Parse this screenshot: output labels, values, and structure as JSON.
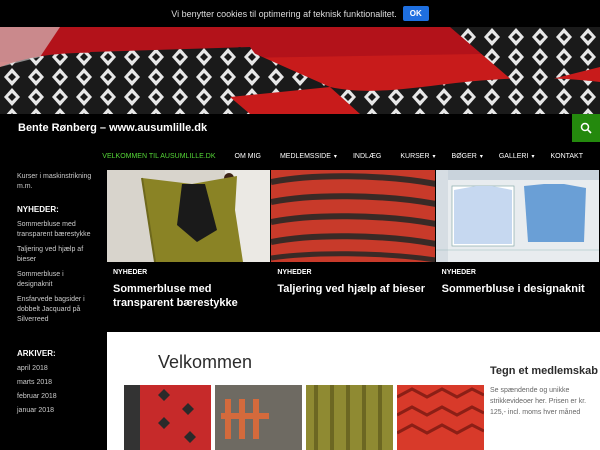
{
  "cookie": {
    "text": "Vi benytter cookies til optimering af teknisk funktionalitet.",
    "ok": "OK"
  },
  "site": {
    "title": "Bente Rønberg – www.ausumlille.dk"
  },
  "nav": [
    {
      "label": "VELKOMMEN TIL AUSUMLILLE.DK",
      "active": true,
      "caret": ""
    },
    {
      "label": "OM MIG",
      "caret": ""
    },
    {
      "label": "MEDLEMSSIDE",
      "caret": "▾"
    },
    {
      "label": "INDLÆG",
      "caret": ""
    },
    {
      "label": "KURSER",
      "caret": "▾"
    },
    {
      "label": "BØGER",
      "caret": "▾"
    },
    {
      "label": "GALLERI",
      "caret": "▾"
    },
    {
      "label": "KONTAKT",
      "caret": ""
    }
  ],
  "sidebar": {
    "description": "Kurser i maskinstrikning m.m.",
    "news_title": "NYHEDER:",
    "news": [
      "Sommerbluse med transparent bærestykke",
      "Taljering ved hjælp af bieser",
      "Sommerbluse i designaknit",
      "Ensfarvede bagsider i dobbelt Jacquard på Silverreed"
    ],
    "archive_title": "ARKIVER:",
    "archive": [
      "april 2018",
      "marts 2018",
      "februar 2018",
      "januar 2018"
    ]
  },
  "featured": [
    {
      "category": "NYHEDER",
      "title": "Sommerbluse med transparent bærestykke"
    },
    {
      "category": "NYHEDER",
      "title": "Taljering ved hjælp af bieser"
    },
    {
      "category": "NYHEDER",
      "title": "Sommerbluse i designaknit"
    }
  ],
  "content": {
    "heading": "Velkommen"
  },
  "widget": {
    "title": "Tegn et medlemskab",
    "text": "Se spændende og unikke strikkevideoer her. Prisen er kr. 125,- incl. moms hver måned"
  },
  "colors": {
    "accent": "#24890d",
    "active_nav": "#55d737",
    "button": "#1e6fe0"
  }
}
